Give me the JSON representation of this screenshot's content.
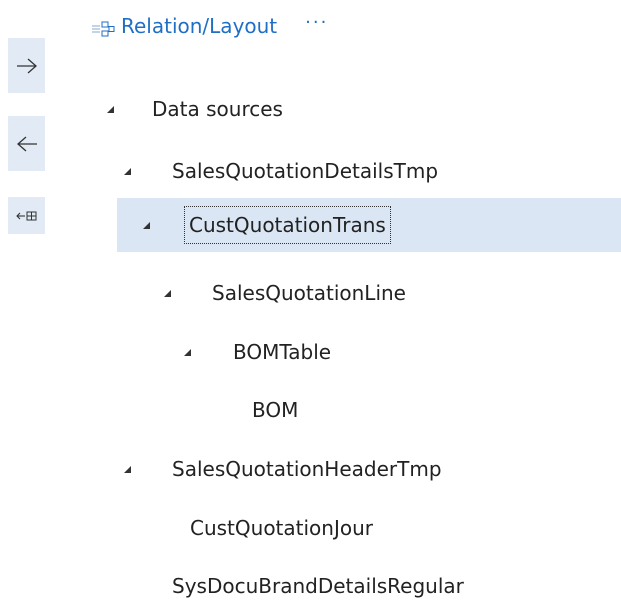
{
  "rail": {
    "forward_icon": "arrow-right-icon",
    "back_icon": "arrow-left-icon",
    "collapse_icon": "arrow-left-grid-icon"
  },
  "header": {
    "icon": "relation-icon",
    "title": "Relation/Layout",
    "more": "···"
  },
  "tree": {
    "nodes": [
      {
        "label": "Data sources",
        "expanded": true
      },
      {
        "label": "SalesQuotationDetailsTmp",
        "expanded": true
      },
      {
        "label": "CustQuotationTrans",
        "expanded": true,
        "selected": true
      },
      {
        "label": "SalesQuotationLine",
        "expanded": true
      },
      {
        "label": "BOMTable",
        "expanded": true
      },
      {
        "label": "BOM"
      },
      {
        "label": "SalesQuotationHeaderTmp",
        "expanded": true
      },
      {
        "label": "CustQuotationJour"
      },
      {
        "label": "SysDocuBrandDetailsRegular"
      }
    ]
  },
  "colors": {
    "accent": "#1f6fc5",
    "rail_button_bg": "#e2ebf5",
    "selected_row_bg": "#dae6f3",
    "text": "#222222"
  }
}
